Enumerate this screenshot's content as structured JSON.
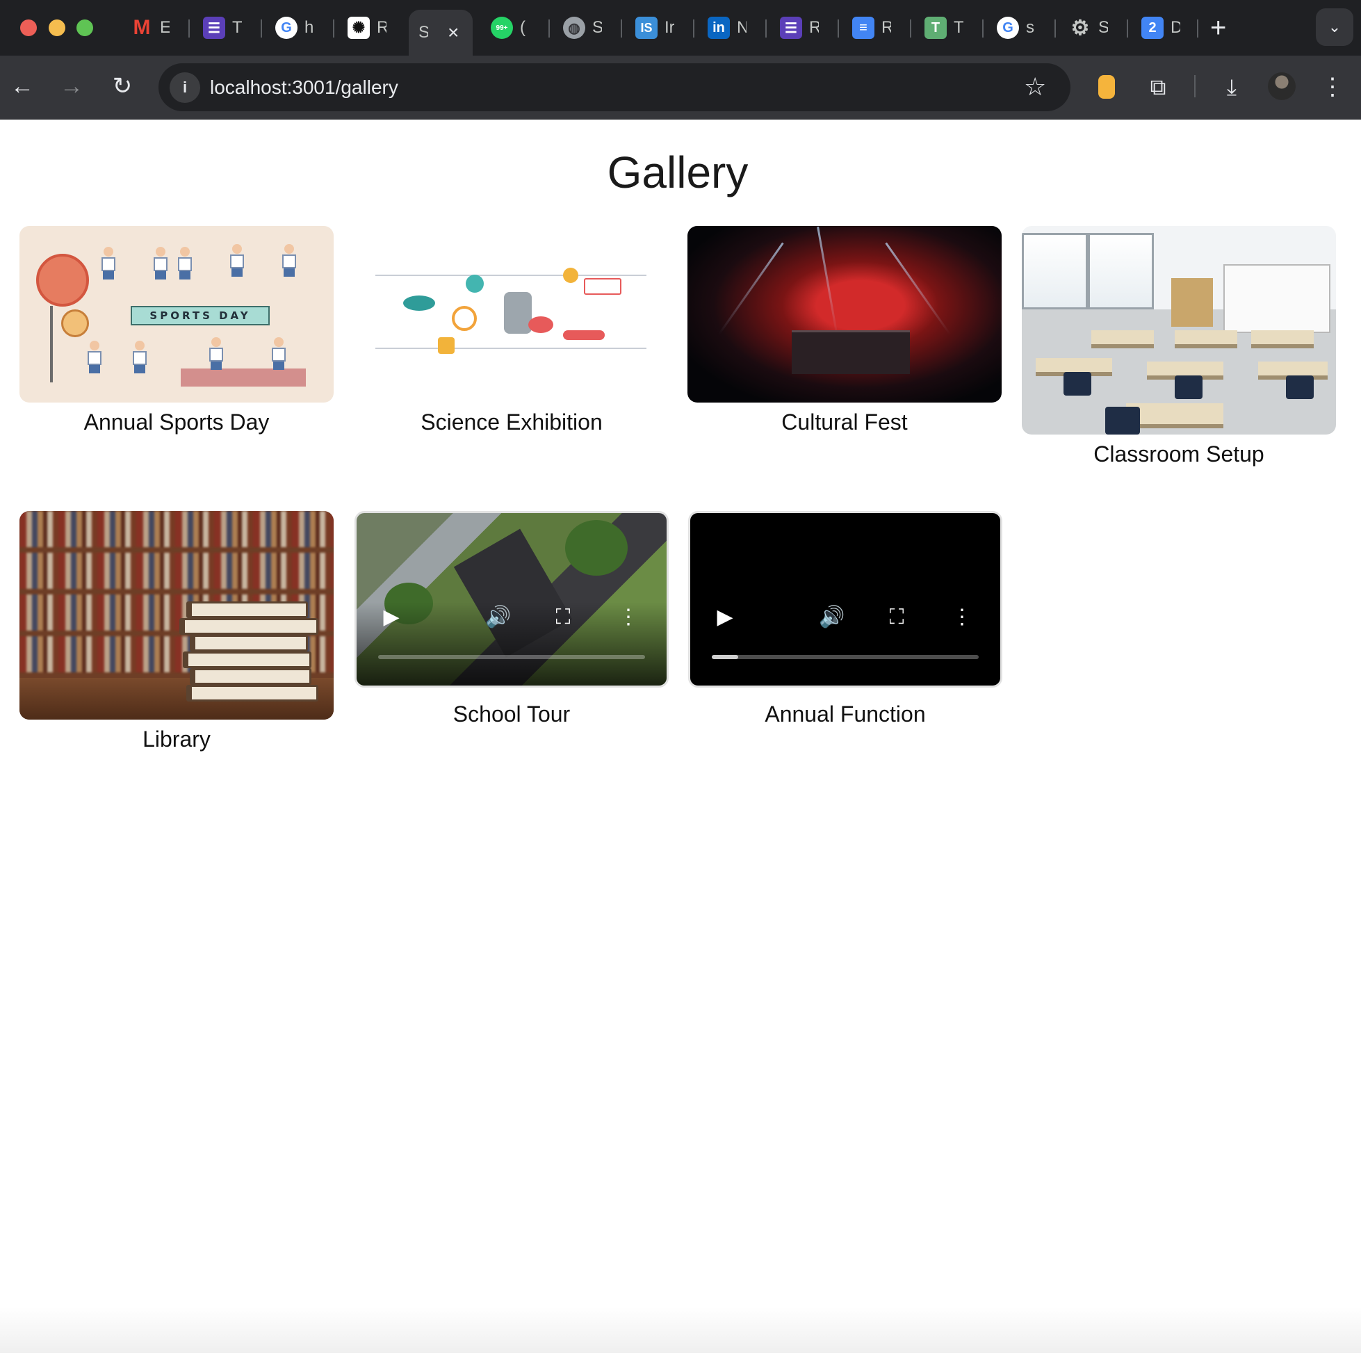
{
  "browser": {
    "tabs": [
      {
        "label": "E",
        "icon": "gmail-icon",
        "color": "#ea4335"
      },
      {
        "label": "T",
        "icon": "list-icon",
        "color": "#5b3fb8"
      },
      {
        "label": "h",
        "icon": "google-icon",
        "color": "#ffffff"
      },
      {
        "label": "R",
        "icon": "chatgpt-icon",
        "color": "#ffffff"
      },
      {
        "label": "S",
        "icon": "",
        "color": "",
        "active": true
      },
      {
        "label": "(",
        "icon": "whatsapp-icon",
        "color": "#25d366",
        "badge": "99+"
      },
      {
        "label": "S",
        "icon": "globe-icon",
        "color": "#9aa0a6"
      },
      {
        "label": "Ir",
        "icon": "is-icon",
        "color": "#3b8fd9",
        "text": "IS"
      },
      {
        "label": "N",
        "icon": "linkedin-icon",
        "color": "#0a66c2",
        "text": "in"
      },
      {
        "label": "R",
        "icon": "list-icon",
        "color": "#5b3fb8"
      },
      {
        "label": "R",
        "icon": "docs-icon",
        "color": "#4285f4"
      },
      {
        "label": "T",
        "icon": "t-icon",
        "color": "#5fae73",
        "text": "T"
      },
      {
        "label": "s",
        "icon": "google-icon",
        "color": "#ffffff"
      },
      {
        "label": "S",
        "icon": "settings-icon",
        "color": "#9aa0a6"
      },
      {
        "label": "D",
        "icon": "calendar-icon",
        "color": "#4285f4",
        "text": "2"
      }
    ],
    "url": "localhost:3001/gallery"
  },
  "page": {
    "title": "Gallery",
    "items": [
      {
        "caption": "Annual Sports Day",
        "type": "image",
        "banner": "SPORTS DAY"
      },
      {
        "caption": "Science Exhibition",
        "type": "image"
      },
      {
        "caption": "Cultural Fest",
        "type": "image"
      },
      {
        "caption": "Classroom Setup",
        "type": "image"
      },
      {
        "caption": "Library",
        "type": "image"
      },
      {
        "caption": "School Tour",
        "type": "video",
        "progress": 0.0
      },
      {
        "caption": "Annual Function",
        "type": "video",
        "progress": 0.1
      }
    ]
  }
}
